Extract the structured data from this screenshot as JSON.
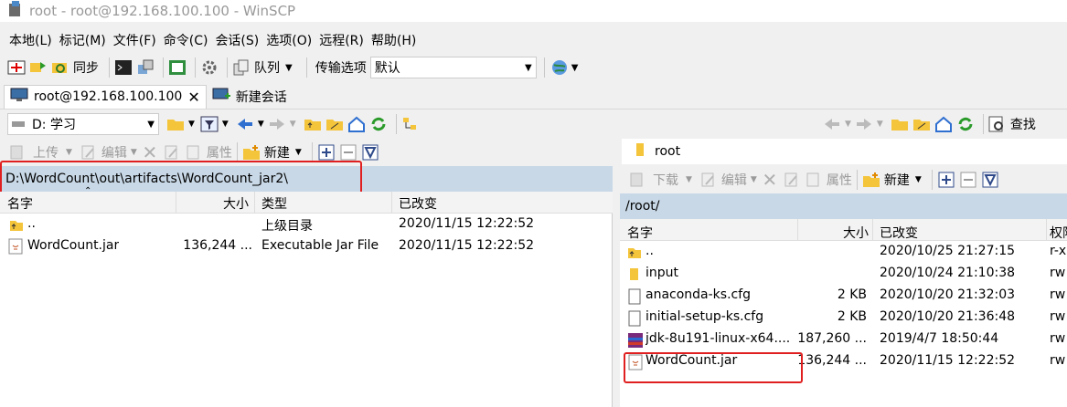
{
  "window": {
    "title": "root - root@192.168.100.100 - WinSCP"
  },
  "menu": [
    "本地(L)",
    "标记(M)",
    "文件(F)",
    "命令(C)",
    "会话(S)",
    "选项(O)",
    "远程(R)",
    "帮助(H)"
  ],
  "toolbar": {
    "sync_label": "同步",
    "queue_label": "队列",
    "transfer_label": "传输选项",
    "transfer_value": "默认"
  },
  "tabs": {
    "session": "root@192.168.100.100",
    "new_session": "新建会话"
  },
  "left": {
    "drive": "D: 学习",
    "actions": {
      "upload": "上传",
      "edit": "编辑",
      "props": "属性",
      "new": "新建"
    },
    "path": "D:\\WordCount\\out\\artifacts\\WordCount_jar2\\",
    "columns": {
      "name": "名字",
      "size": "大小",
      "type": "类型",
      "changed": "已改变"
    },
    "files": [
      {
        "name": "..",
        "size": "",
        "type": "上级目录",
        "changed": "2020/11/15  12:22:52"
      },
      {
        "name": "WordCount.jar",
        "size": "136,244 ...",
        "type": "Executable Jar File",
        "changed": "2020/11/15  12:22:52"
      }
    ]
  },
  "right": {
    "folder": "root",
    "search_label": "查找",
    "actions": {
      "download": "下载",
      "edit": "编辑",
      "props": "属性",
      "new": "新建"
    },
    "path": "/root/",
    "columns": {
      "name": "名字",
      "size": "大小",
      "changed": "已改变",
      "perms": "权限"
    },
    "files": [
      {
        "name": "..",
        "size": "",
        "changed": "2020/10/25 21:27:15",
        "perms": "r-x",
        "icon": "parent-folder-icon"
      },
      {
        "name": "input",
        "size": "",
        "changed": "2020/10/24 21:10:38",
        "perms": "rw",
        "icon": "folder-icon"
      },
      {
        "name": "anaconda-ks.cfg",
        "size": "2 KB",
        "changed": "2020/10/20 21:32:03",
        "perms": "rw",
        "icon": "file-icon"
      },
      {
        "name": "initial-setup-ks.cfg",
        "size": "2 KB",
        "changed": "2020/10/20 21:36:48",
        "perms": "rw",
        "icon": "file-icon"
      },
      {
        "name": "jdk-8u191-linux-x64....",
        "size": "187,260 ...",
        "changed": "2019/4/7 18:50:44",
        "perms": "rw",
        "icon": "archive-icon"
      },
      {
        "name": "WordCount.jar",
        "size": "136,244 ...",
        "changed": "2020/11/15 12:22:52",
        "perms": "rw",
        "icon": "jar-icon"
      }
    ]
  },
  "colors": {
    "highlight": "#e02020",
    "pathbar": "#c8d8e6",
    "accent": "#1e6fc0"
  }
}
